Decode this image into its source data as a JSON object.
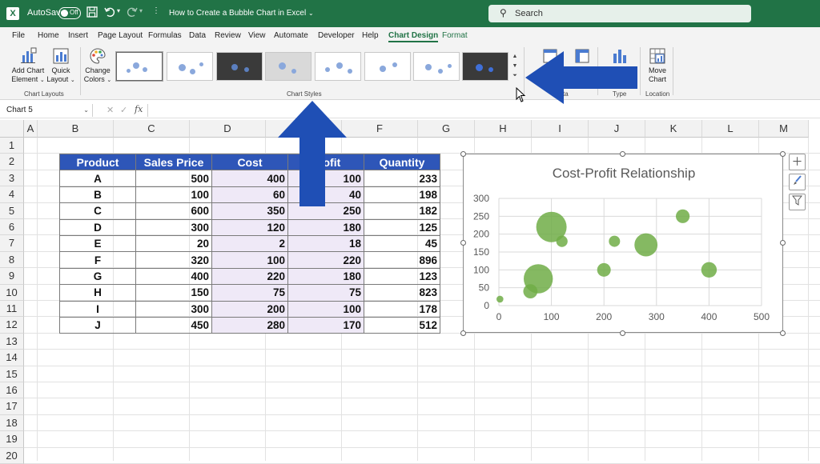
{
  "titlebar": {
    "logo": "X",
    "autosave_label": "AutoSave",
    "toggle_state": "Off",
    "doc_title": "How to Create a Bubble Chart in Excel",
    "search_placeholder": "Search",
    "accent": "#217346"
  },
  "menu": {
    "items": [
      "File",
      "Home",
      "Insert",
      "Page Layout",
      "Formulas",
      "Data",
      "Review",
      "View",
      "Automate",
      "Developer",
      "Help",
      "Chart Design",
      "Format"
    ],
    "active": "Chart Design"
  },
  "ribbon": {
    "add_chart_element": [
      "Add Chart",
      "Element"
    ],
    "quick_layout": [
      "Quick",
      "Layout"
    ],
    "change_colors": [
      "Change",
      "Colors"
    ],
    "move_chart": [
      "Move",
      "Chart"
    ],
    "groups": {
      "chart_layouts": "Chart Layouts",
      "chart_styles": "Chart Styles",
      "data_partial": "ta",
      "type": "Type",
      "location": "Location"
    }
  },
  "formula_bar": {
    "name_box": "Chart 5",
    "fx": "fx",
    "value": ""
  },
  "columns": [
    "A",
    "B",
    "C",
    "D",
    "E",
    "F",
    "G",
    "H",
    "I",
    "J",
    "K",
    "L",
    "M"
  ],
  "rows": [
    "1",
    "2",
    "3",
    "4",
    "5",
    "6",
    "7",
    "8",
    "9",
    "10",
    "11",
    "12",
    "13",
    "14",
    "15",
    "16",
    "17",
    "18",
    "19",
    "20"
  ],
  "table": {
    "headers": [
      "Product",
      "Sales Price",
      "Cost",
      "Profit",
      "Quantity"
    ],
    "rows": [
      [
        "A",
        "500",
        "400",
        "100",
        "233"
      ],
      [
        "B",
        "100",
        "60",
        "40",
        "198"
      ],
      [
        "C",
        "600",
        "350",
        "250",
        "182"
      ],
      [
        "D",
        "300",
        "120",
        "180",
        "125"
      ],
      [
        "E",
        "20",
        "2",
        "18",
        "45"
      ],
      [
        "F",
        "320",
        "100",
        "220",
        "896"
      ],
      [
        "G",
        "400",
        "220",
        "180",
        "123"
      ],
      [
        "H",
        "150",
        "75",
        "75",
        "823"
      ],
      [
        "I",
        "300",
        "200",
        "100",
        "178"
      ],
      [
        "J",
        "450",
        "280",
        "170",
        "512"
      ]
    ],
    "header_color": "#2e56b8"
  },
  "chart_data": {
    "type": "scatter",
    "subtype": "bubble",
    "title": "Cost-Profit Relationship",
    "xlabel": "",
    "ylabel": "",
    "xlim": [
      0,
      500
    ],
    "ylim": [
      0,
      300
    ],
    "x_ticks": [
      "0",
      "100",
      "200",
      "300",
      "400",
      "500"
    ],
    "y_ticks": [
      "0",
      "50",
      "100",
      "150",
      "200",
      "250",
      "300"
    ],
    "grid": true,
    "bubble_color": "#70ad47",
    "points": [
      {
        "x": 400,
        "y": 100,
        "size": 233
      },
      {
        "x": 60,
        "y": 40,
        "size": 198
      },
      {
        "x": 350,
        "y": 250,
        "size": 182
      },
      {
        "x": 120,
        "y": 180,
        "size": 125
      },
      {
        "x": 2,
        "y": 18,
        "size": 45
      },
      {
        "x": 100,
        "y": 220,
        "size": 896
      },
      {
        "x": 220,
        "y": 180,
        "size": 123
      },
      {
        "x": 75,
        "y": 75,
        "size": 823
      },
      {
        "x": 200,
        "y": 100,
        "size": 178
      },
      {
        "x": 280,
        "y": 170,
        "size": 512
      }
    ]
  },
  "annotation": {
    "arrow_color": "#1f4fb5"
  }
}
